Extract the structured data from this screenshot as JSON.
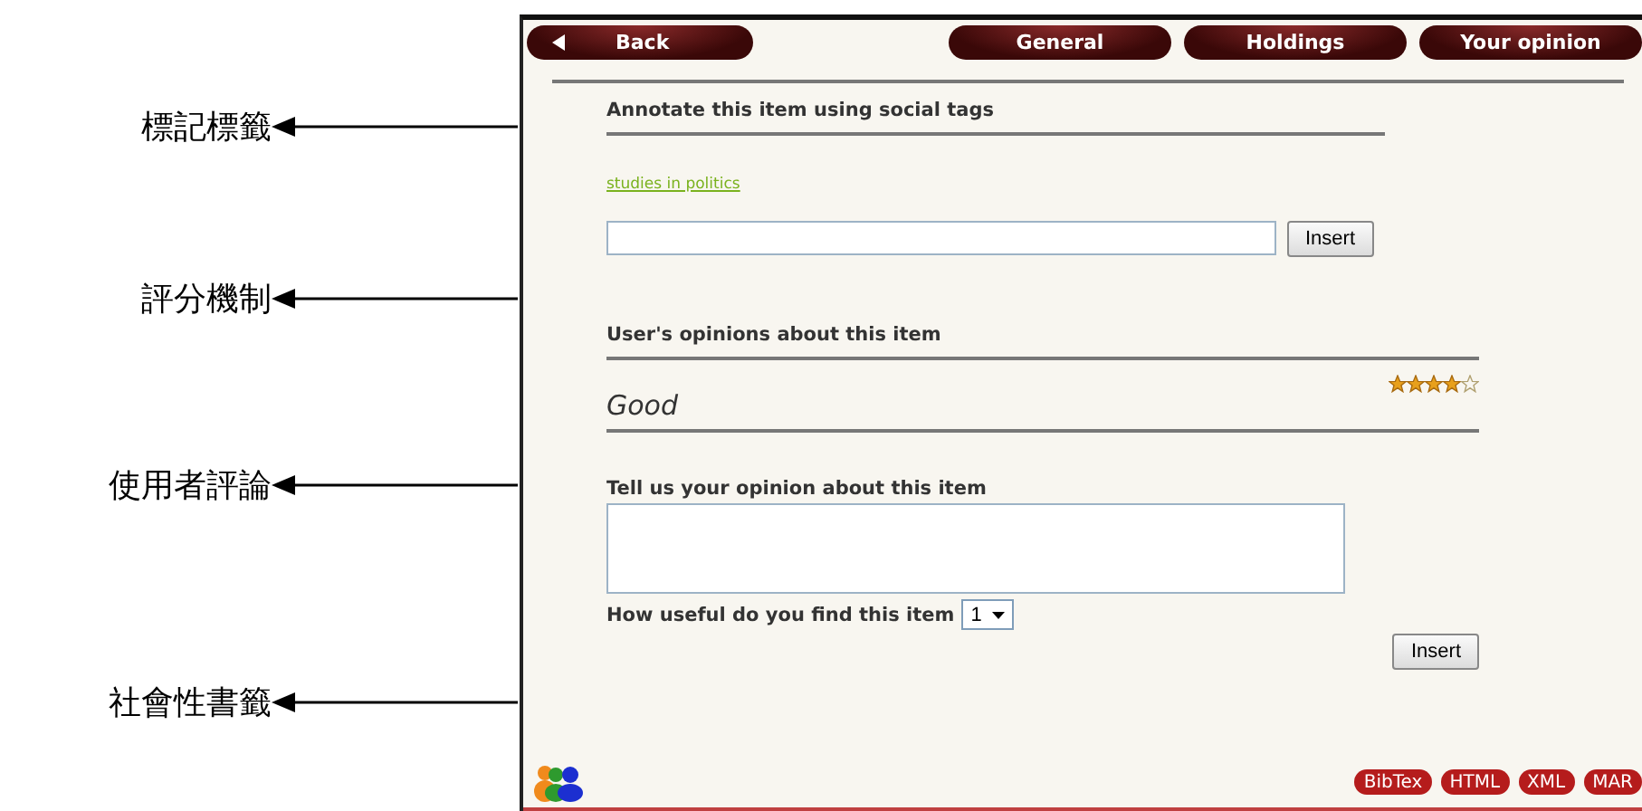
{
  "annotations": [
    {
      "label": "標記標籤"
    },
    {
      "label": "評分機制"
    },
    {
      "label": "使用者評論"
    },
    {
      "label": "社會性書籤"
    }
  ],
  "nav": {
    "back": "Back",
    "tabs": [
      "General",
      "Holdings",
      "Your opinion"
    ]
  },
  "tags": {
    "heading": "Annotate this item using social tags",
    "tag_link": "studies in politics",
    "button": "Insert"
  },
  "opinions": {
    "heading": "User's opinions about this item",
    "items": [
      {
        "stars": 4,
        "text": "Good"
      }
    ]
  },
  "form": {
    "heading": "Tell us your opinion about this item",
    "usefulness_label": "How useful do you find this item",
    "usefulness_value": "1",
    "button": "Insert"
  },
  "export_buttons": [
    "BibTex",
    "HTML",
    "XML",
    "MAR"
  ]
}
